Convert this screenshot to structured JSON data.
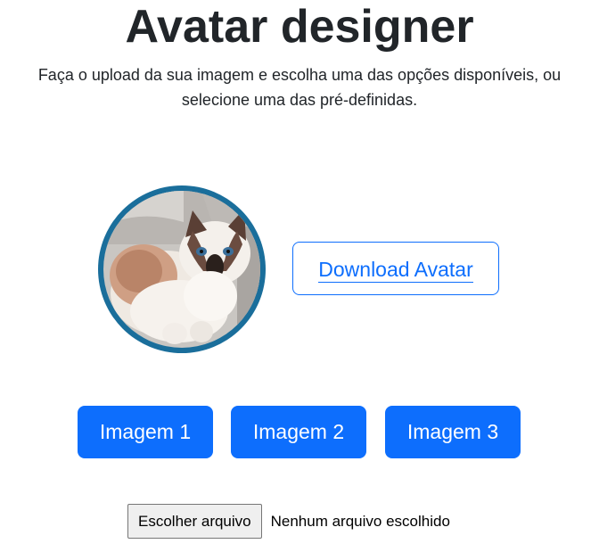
{
  "header": {
    "title": "Avatar designer",
    "subtitle": "Faça o upload da sua imagem e escolha uma das opções disponíveis, ou selecione uma das pré-definidas."
  },
  "avatar": {
    "alt": "cat avatar",
    "ring_color": "#1a6e9b"
  },
  "actions": {
    "download_label": "Download Avatar"
  },
  "presets": [
    {
      "label": "Imagem 1"
    },
    {
      "label": "Imagem 2"
    },
    {
      "label": "Imagem 3"
    }
  ],
  "upload": {
    "button_label": "Escolher arquivo",
    "status": "Nenhum arquivo escolhido"
  },
  "colors": {
    "primary": "#0d6efd",
    "text": "#212529"
  }
}
